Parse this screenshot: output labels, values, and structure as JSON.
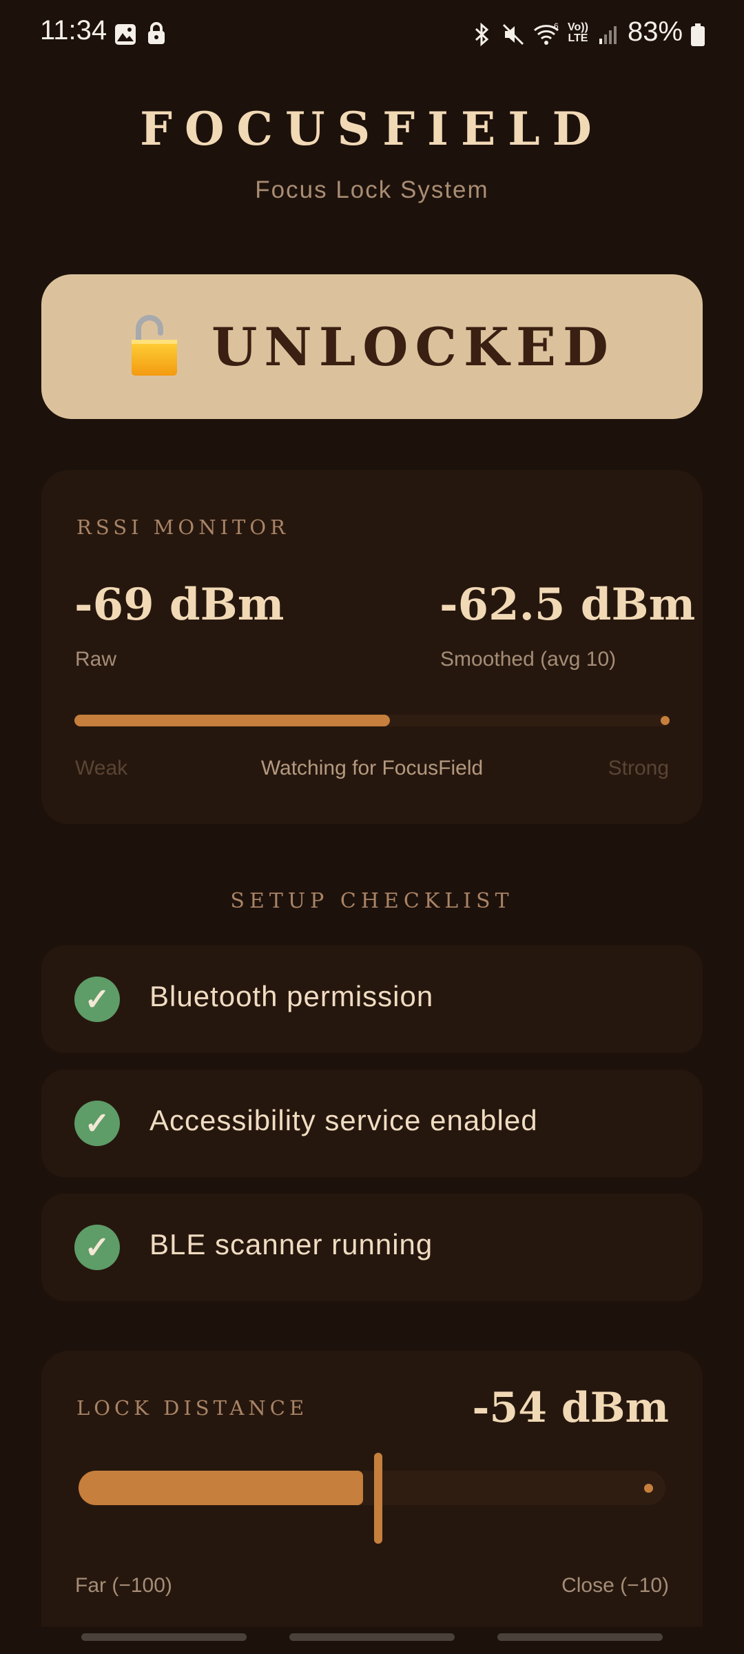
{
  "status_bar": {
    "time": "11:34",
    "battery": "83%",
    "icons": [
      "image-icon",
      "lock-icon",
      "bluetooth-icon",
      "mute-icon",
      "wifi-icon",
      "volte-icon",
      "signal-icon",
      "battery-icon"
    ],
    "volte_top": "Vo))",
    "volte_bottom": "LTE"
  },
  "header": {
    "title": "FOCUSFIELD",
    "subtitle": "Focus Lock System"
  },
  "lock_status": {
    "icon": "open-padlock-icon",
    "label": "UNLOCKED"
  },
  "rssi_monitor": {
    "section_title": "RSSI MONITOR",
    "raw_value": "-69 dBm",
    "raw_label": "Raw",
    "smoothed_value": "-62.5 dBm",
    "smoothed_label": "Smoothed (avg 10)",
    "signal_level": 0.53,
    "weak_label": "Weak",
    "status_text": "Watching for FocusField",
    "strong_label": "Strong"
  },
  "checklist": {
    "section_title": "SETUP CHECKLIST",
    "items": [
      {
        "label": "Bluetooth permission",
        "check": "✓"
      },
      {
        "label": "Accessibility service enabled",
        "check": "✓"
      },
      {
        "label": "BLE scanner running",
        "check": "✓"
      }
    ]
  },
  "lock_distance": {
    "section_title": "LOCK DISTANCE",
    "value": "-54 dBm",
    "slider_level": 0.51,
    "far_label": "Far  (−100)",
    "close_label": "Close  (−10)"
  },
  "colors": {
    "background": "#1d110b",
    "card": "#26170e",
    "accent": "#c67f3c",
    "lock_card": "#dcc29c",
    "check_green": "#5e9c68"
  }
}
